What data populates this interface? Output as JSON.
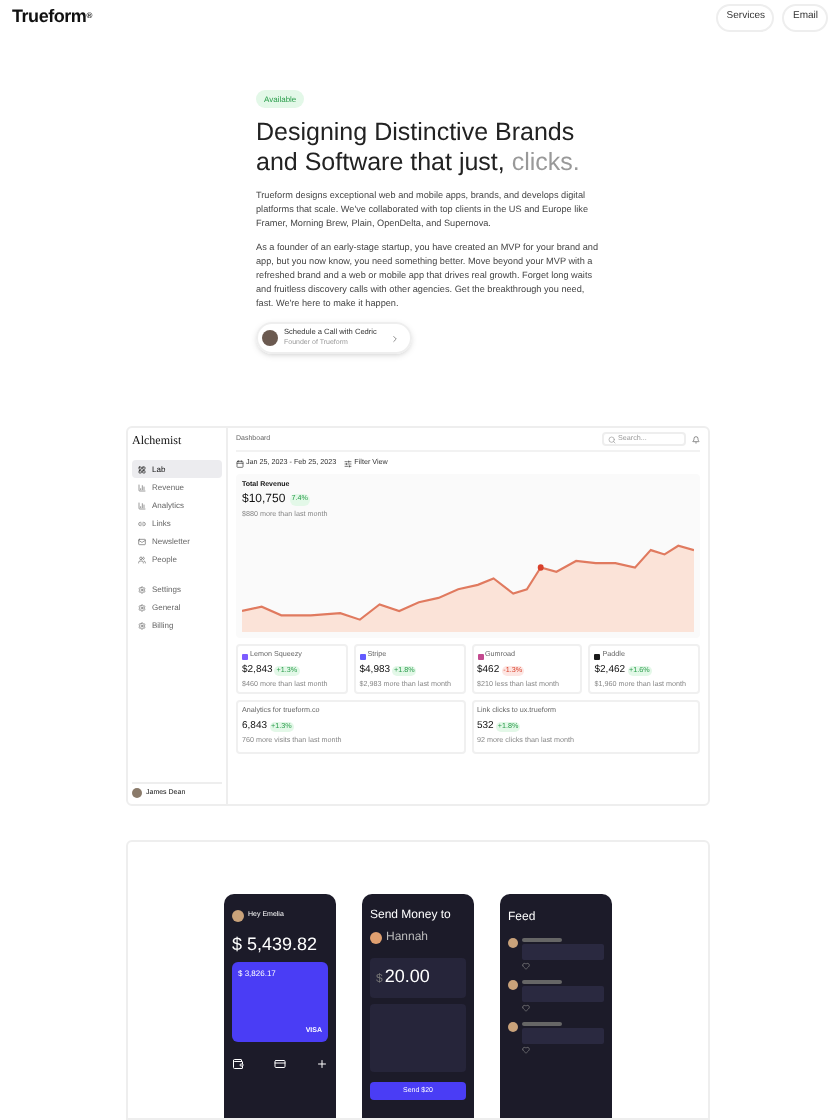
{
  "header": {
    "logo": "Trueform",
    "logo_mark": "®",
    "nav": [
      "Services",
      "Email"
    ]
  },
  "hero": {
    "badge": "Available",
    "heading": "Designing Distinctive Brands and Software that just,",
    "heading_accent": "clicks.",
    "paragraphs": [
      "Trueform designs exceptional web and mobile apps, brands, and develops digital platforms that scale. We've collaborated with top clients in the US and Europe like Framer, Morning Brew, Plain, OpenDelta, and Supernova.",
      "As a founder of an early-stage startup, you have created an MVP for your brand and app, but you now know, you need something better. Move beyond your MVP with a refreshed brand and a web or mobile app that drives real growth. Forget long waits and fruitless discovery calls with other agencies. Get the breakthrough you need, fast. We're here to make it happen."
    ],
    "cta": {
      "title": "Schedule a Call with Cedric",
      "subtitle": "Founder of Trueform"
    }
  },
  "dashboard": {
    "logo": "Alchemist",
    "sidebar": [
      {
        "label": "Lab",
        "selected": true
      },
      {
        "label": "Revenue",
        "selected": false
      },
      {
        "label": "Analytics",
        "selected": false
      },
      {
        "label": "Links",
        "selected": false
      },
      {
        "label": "Newsletter",
        "selected": false
      },
      {
        "label": "People",
        "selected": false
      }
    ],
    "sidebar_bottom": [
      {
        "label": "Settings",
        "selected": false
      },
      {
        "label": "General",
        "selected": false
      },
      {
        "label": "Billing",
        "selected": false
      }
    ],
    "user": "James Dean",
    "breadcrumb": "Dashboard",
    "search": {
      "placeholder": "Search..."
    },
    "date_range": "Jan 25, 2023 - Feb 25, 2023",
    "filter": "Filter View",
    "revenue": {
      "title": "Total Revenue",
      "value": "$10,750",
      "change": "7.4%",
      "note": "$880 more than last month"
    },
    "stats": [
      {
        "name": "Lemon Squeezy",
        "color": "#7c5cff",
        "value": "$2,843",
        "change": "+1.3%",
        "negative": false,
        "note": "$460 more than last month"
      },
      {
        "name": "Stripe",
        "color": "#635bff",
        "value": "$4,983",
        "change": "+1.8%",
        "negative": false,
        "note": "$2,983 more than last month"
      },
      {
        "name": "Gumroad",
        "color": "#c34a8f",
        "value": "$462",
        "change": "-1.3%",
        "negative": true,
        "note": "$210 less than last month"
      },
      {
        "name": "Paddle",
        "color": "#1a1a1a",
        "value": "$2,462",
        "change": "+1.6%",
        "negative": false,
        "note": "$1,960 more than last month"
      }
    ],
    "metrics": [
      {
        "name": "Analytics for trueform.co",
        "value": "6,843",
        "change": "+1.3%",
        "note": "760 more visits than last month"
      },
      {
        "name": "Link clicks to ux.trueform",
        "value": "532",
        "change": "+1.8%",
        "note": "92 more clicks than last month"
      }
    ]
  },
  "phones": [
    {
      "kind": "wallet",
      "title": "Hey Emelia",
      "balance": "$ 5,439.82",
      "card_amount": "$ 3,826.17",
      "card_brand": "VISA"
    },
    {
      "kind": "send",
      "title": "Send Money to",
      "recipient": "Hannah",
      "currency": "$",
      "amount": "20.00",
      "button": "Send $20"
    },
    {
      "kind": "feed",
      "title": "Feed"
    }
  ]
}
